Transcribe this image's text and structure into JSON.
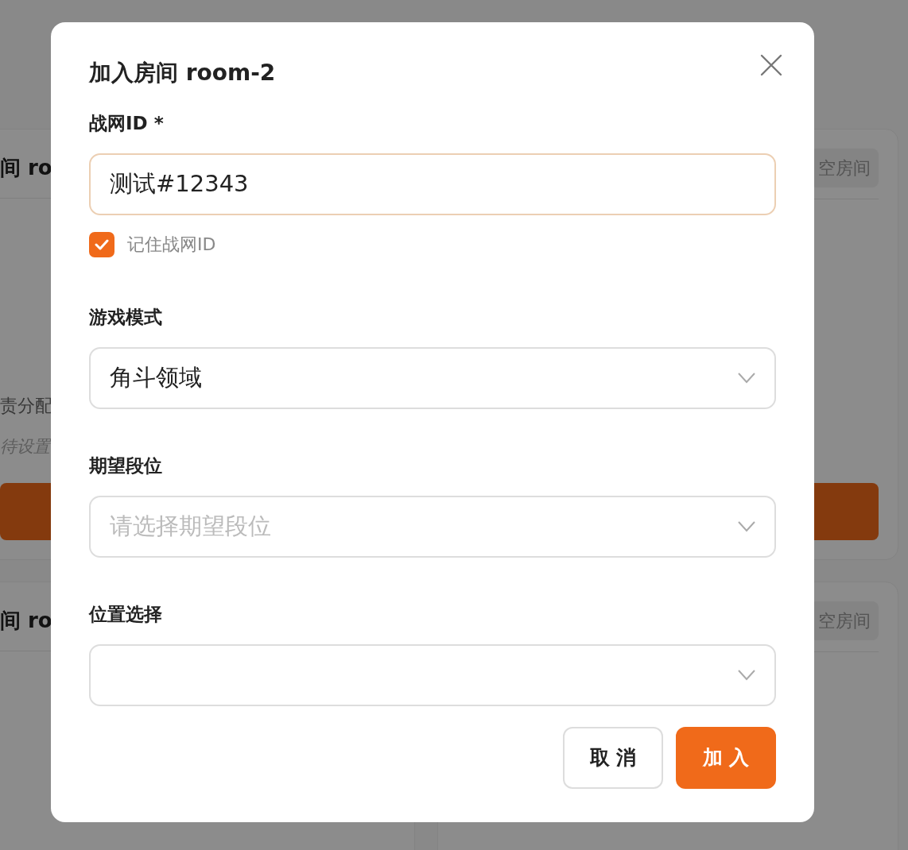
{
  "background": {
    "left_cards": [
      {
        "title": "间 ro",
        "role_label": "责分配",
        "role_value": "待设置",
        "has_button": true
      },
      {
        "title": "间 ro",
        "has_button": false
      }
    ],
    "right_cards": [
      {
        "badge": "空房间",
        "has_button": true
      },
      {
        "badge": "空房间",
        "has_button": false
      }
    ]
  },
  "dialog": {
    "title": "加入房间 room-2",
    "fields": [
      {
        "kind": "text",
        "label": "战网ID *",
        "value": "测试#12343",
        "focused": true
      },
      {
        "kind": "checkbox",
        "label": "记住战网ID",
        "checked": true
      },
      {
        "kind": "select",
        "label": "游戏模式",
        "value": "角斗领域"
      },
      {
        "kind": "select",
        "label": "期望段位",
        "placeholder": "请选择期望段位"
      },
      {
        "kind": "select",
        "label": "位置选择"
      }
    ],
    "buttons": [
      {
        "label": "取 消",
        "kind": "secondary"
      },
      {
        "label": "加 入",
        "kind": "primary"
      }
    ]
  }
}
